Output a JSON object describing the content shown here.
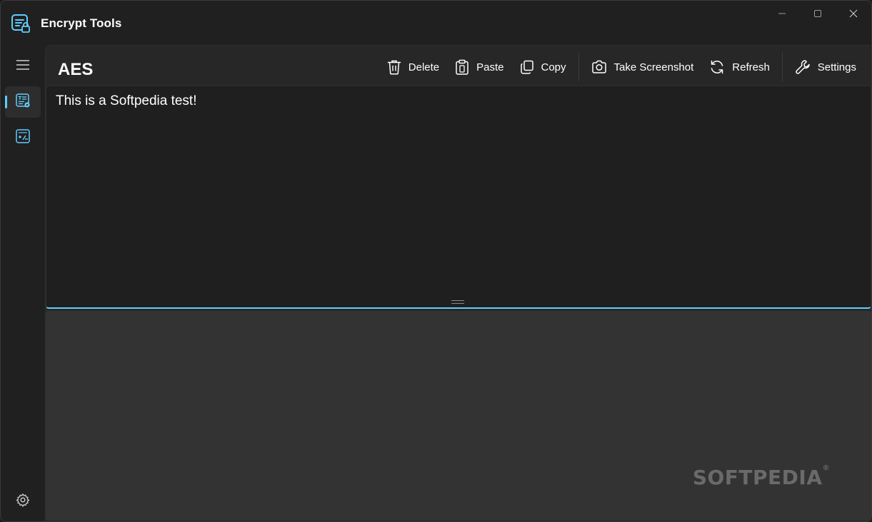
{
  "window": {
    "title": "Encrypt Tools",
    "controls": [
      "minimize-icon",
      "maximize-icon",
      "close-icon"
    ]
  },
  "nav": {
    "items": [
      {
        "icon": "menu-icon"
      },
      {
        "icon": "text-encrypt-icon",
        "active": true
      },
      {
        "icon": "hash-icon"
      }
    ],
    "footer_icon": "gear-icon"
  },
  "page": {
    "title": "AES"
  },
  "toolbar": {
    "delete_label": "Delete",
    "paste_label": "Paste",
    "copy_label": "Copy",
    "screenshot_label": "Take Screenshot",
    "refresh_label": "Refresh",
    "settings_label": "Settings"
  },
  "input": {
    "value": "This is a Softpedia test!"
  },
  "watermark": {
    "text": "SOFTPEDIA",
    "mark": "®"
  },
  "colors": {
    "accent": "#60cdff",
    "background": "#202020",
    "panel": "#272727",
    "input_bg": "#1f1f1f",
    "output_bg": "#333333"
  }
}
